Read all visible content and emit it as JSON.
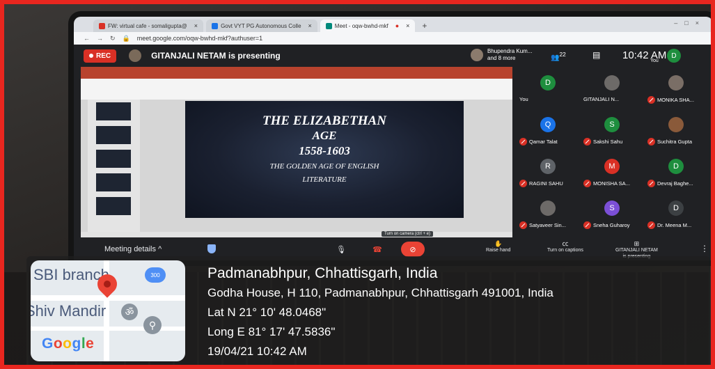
{
  "browser": {
    "tabs": [
      {
        "label": "FW: virtual cafe - somaligupta@",
        "active": false
      },
      {
        "label": "Govt VYT PG Autonomous Colle",
        "active": false
      },
      {
        "label": "Meet - oqw-bwhd-mkf",
        "active": true
      }
    ],
    "url": "meet.google.com/oqw-bwhd-mkf?authuser=1"
  },
  "meet": {
    "rec_label": "REC",
    "presenting_text": "GITANJALI NETAM is presenting",
    "others_name": "Bhupendra Kum...",
    "others_more": "and 8 more",
    "people_count": "22",
    "time": "10:42 AM",
    "you_label": "You",
    "you_initial": "D"
  },
  "slide": {
    "line1": "THE ELIZABETHAN",
    "line2": "AGE",
    "line3": "1558-1603",
    "line4": "THE GOLDEN AGE OF ENGLISH",
    "line5": "LITERATURE"
  },
  "participants": [
    {
      "name": "You",
      "initial": "D",
      "color": "#1e8e3e",
      "muted": false
    },
    {
      "name": "GITANJALI N...",
      "initial": "",
      "color": "#6d6a68",
      "muted": false
    },
    {
      "name": "MONIKA SHA...",
      "initial": "",
      "color": "#7a6e66",
      "muted": true
    },
    {
      "name": "Qamar Talat",
      "initial": "Q",
      "color": "#1a73e8",
      "muted": true
    },
    {
      "name": "Sakshi Sahu",
      "initial": "S",
      "color": "#1e8e3e",
      "muted": true
    },
    {
      "name": "Suchitra Gupta",
      "initial": "",
      "color": "#8a5a3a",
      "muted": true
    },
    {
      "name": "RAGINI SAHU",
      "initial": "R",
      "color": "#5f6368",
      "muted": true
    },
    {
      "name": "MONISHA SA...",
      "initial": "M",
      "color": "#d93025",
      "muted": true
    },
    {
      "name": "Devraj Baghe...",
      "initial": "D",
      "color": "#1e8e3e",
      "muted": true
    },
    {
      "name": "Satyaveer Sin...",
      "initial": "",
      "color": "#6d6a68",
      "muted": true
    },
    {
      "name": "Sneha Guharoy",
      "initial": "S",
      "color": "#7b4fd6",
      "muted": true
    },
    {
      "name": "Dr. Meena M...",
      "initial": "D",
      "color": "#3c4043",
      "muted": true
    }
  ],
  "controls": {
    "meeting_details": "Meeting details",
    "camera_tooltip": "Turn on camera (ctrl + e)",
    "raise_hand": "Raise hand",
    "captions": "Turn on captions",
    "presenter_line1": "GITANJALI NETAM",
    "presenter_line2": "is presenting"
  },
  "gps": {
    "map_label_1": "SBI branch",
    "map_label_2": "Shiv Mandir",
    "map_bus": "300",
    "google_logo": "Google",
    "place": "Padmanabhpur, Chhattisgarh, India",
    "address": "Godha House, H 110, Padmanabhpur, Chhattisgarh 491001, India",
    "lat": "Lat N 21° 10' 48.0468\"",
    "long": "Long E 81° 17' 47.5836\"",
    "datetime": "19/04/21 10:42 AM"
  }
}
